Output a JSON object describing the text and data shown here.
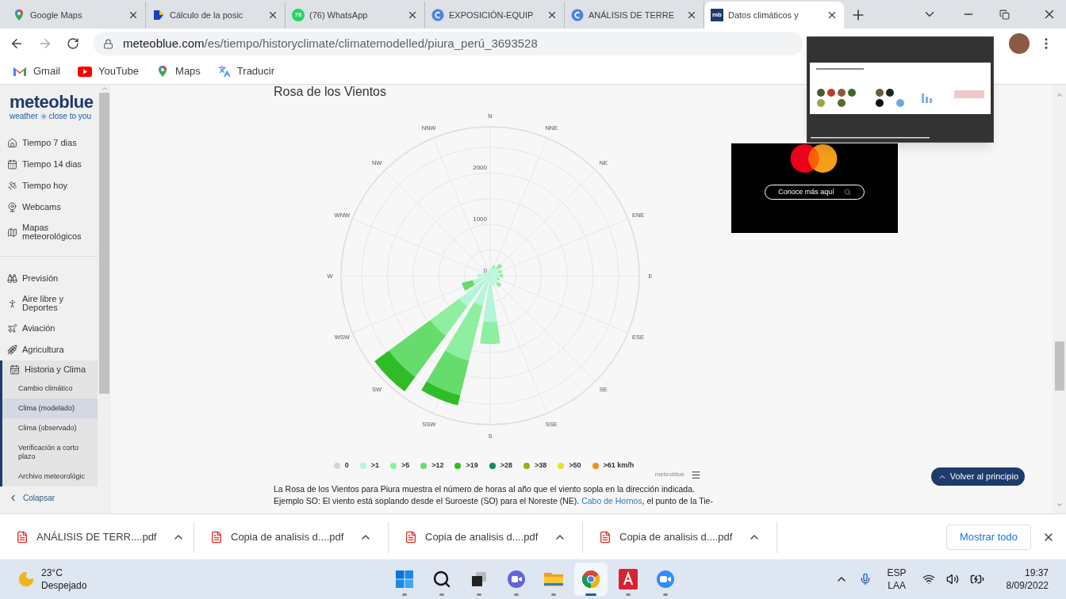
{
  "tabs": [
    {
      "label": "Google Maps",
      "selected": false
    },
    {
      "label": "Cálculo de la posic",
      "selected": false
    },
    {
      "badge": "76",
      "label": "(76) WhatsApp",
      "selected": false
    },
    {
      "label": "EXPOSICIÓN-EQUIP",
      "selected": false
    },
    {
      "label": "ANÁLISIS DE TERRE",
      "selected": false
    },
    {
      "icon_text": "mb",
      "label": "Datos climáticos y",
      "selected": true
    }
  ],
  "address": {
    "host": "meteoblue.com",
    "path": "/es/tiempo/historyclimate/climatemodelled/piura_perú_3693528"
  },
  "bookmarks": [
    {
      "label": "Gmail"
    },
    {
      "label": "YouTube"
    },
    {
      "label": "Maps"
    },
    {
      "label": "Traducir"
    }
  ],
  "sidebar": {
    "logo": "meteoblue",
    "tagline_left": "weather",
    "tagline_right": "close to you",
    "sections": [
      {
        "items": [
          {
            "label": "Tiempo 7 dias"
          },
          {
            "label": "Tiempo 14 dias"
          },
          {
            "label": "Tiempo hoy"
          },
          {
            "label": "Webcams"
          },
          {
            "label": "Mapas meteorológicos"
          }
        ]
      },
      {
        "items": [
          {
            "label": "Previsión"
          },
          {
            "label": "Aire libre y Deportes"
          },
          {
            "label": "Aviación"
          },
          {
            "label": "Agricultura"
          },
          {
            "label": "Historia y Clima",
            "expanded": true,
            "children": [
              {
                "label": "Cambio climático",
                "selected": false
              },
              {
                "label": "Clima (modelado)",
                "selected": true
              },
              {
                "label": "Clima (observado)",
                "selected": false
              },
              {
                "label": "Verificación a corto plazo",
                "selected": false
              },
              {
                "label": "Archivo meteorológic",
                "selected": false
              }
            ]
          }
        ]
      }
    ],
    "collapse": "Colapsar"
  },
  "wind_rose": {
    "title": "Rosa de los Vientos",
    "credit": "meteoblue",
    "radial_labels": [
      "2000",
      "1000",
      "0"
    ],
    "directions": [
      "N",
      "NNE",
      "NE",
      "ENE",
      "E",
      "ESE",
      "SE",
      "SSE",
      "S",
      "SSW",
      "SW",
      "WSW",
      "W",
      "WNW",
      "NW",
      "NNW"
    ],
    "legend": [
      {
        "label": "0",
        "color": "#d4d4d8"
      },
      {
        "label": ">1",
        "color": "#b2f5d8"
      },
      {
        "label": ">5",
        "color": "#8def9f"
      },
      {
        "label": ">12",
        "color": "#66dc6d"
      },
      {
        "label": ">19",
        "color": "#2fbd27"
      },
      {
        "label": ">28",
        "color": "#0f8a5c"
      },
      {
        "label": ">38",
        "color": "#8cb418"
      },
      {
        "label": ">50",
        "color": "#e2e226"
      },
      {
        "label": ">61 km/h",
        "color": "#f2901c"
      }
    ],
    "description_line1": "La Rosa de los Vientos para Piura muestra el número de horas al año que el viento sopla en la dirección indicada.",
    "description_line2_before": "Ejemplo SO: El viento está soplando desde el Suroeste (SO) para el Noreste (NE).",
    "description_link": "Cabo de Hornos",
    "description_line2_after": ", el punto de la Tie-"
  },
  "ad": {
    "button": "Conoce más aquí"
  },
  "back_to_top": "Volver al principio",
  "downloads": [
    {
      "name": "ANÁLISIS DE TERR....pdf"
    },
    {
      "name": "Copia de analisis d....pdf"
    },
    {
      "name": "Copia de analisis d....pdf"
    },
    {
      "name": "Copia de analisis d....pdf"
    }
  ],
  "show_all": "Mostrar todo",
  "taskbar": {
    "temperature": "23°C",
    "condition": "Despejado",
    "apps": [
      {
        "selected": false
      },
      {
        "selected": false
      },
      {
        "selected": false
      },
      {
        "selected": false
      },
      {
        "selected": false
      },
      {
        "selected": true
      },
      {
        "selected": false
      },
      {
        "selected": false
      }
    ],
    "language": "ESP",
    "layout": "LAA",
    "time": "19:37",
    "date": "8/09/2022"
  }
}
